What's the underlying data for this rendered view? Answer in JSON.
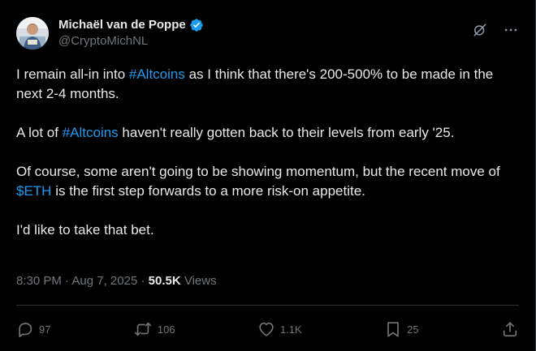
{
  "author": {
    "name": "Michaël van de Poppe",
    "handle": "@CryptoMichNL",
    "verified": true
  },
  "post": {
    "p1_a": "I remain all-in into ",
    "p1_tag": "#Altcoins",
    "p1_b": " as I think that there's 200-500% to be made in the next 2-4 months.",
    "p2_a": "A lot of ",
    "p2_tag": "#Altcoins",
    "p2_b": " haven't really gotten back to their levels from early '25.",
    "p3_a": "Of course, some aren't going to be showing momentum, but the recent move of ",
    "p3_tag": "$ETH",
    "p3_b": " is the first step forwards to a more risk-on appetite.",
    "p4": "I'd like to take that bet."
  },
  "meta": {
    "time": "8:30 PM",
    "sep": " · ",
    "date": "Aug 7, 2025",
    "views_count": "50.5K",
    "views_label": "Views"
  },
  "actions": {
    "replies": "97",
    "reposts": "106",
    "likes": "1.1K",
    "bookmarks": "25"
  },
  "colors": {
    "background": "#000000",
    "text": "#e7e9ea",
    "secondary": "#71767b",
    "link": "#1d9bf0"
  },
  "icons": [
    "verified-badge-icon",
    "grok-icon",
    "more-icon",
    "reply-icon",
    "repost-icon",
    "like-icon",
    "bookmark-icon",
    "share-icon"
  ]
}
